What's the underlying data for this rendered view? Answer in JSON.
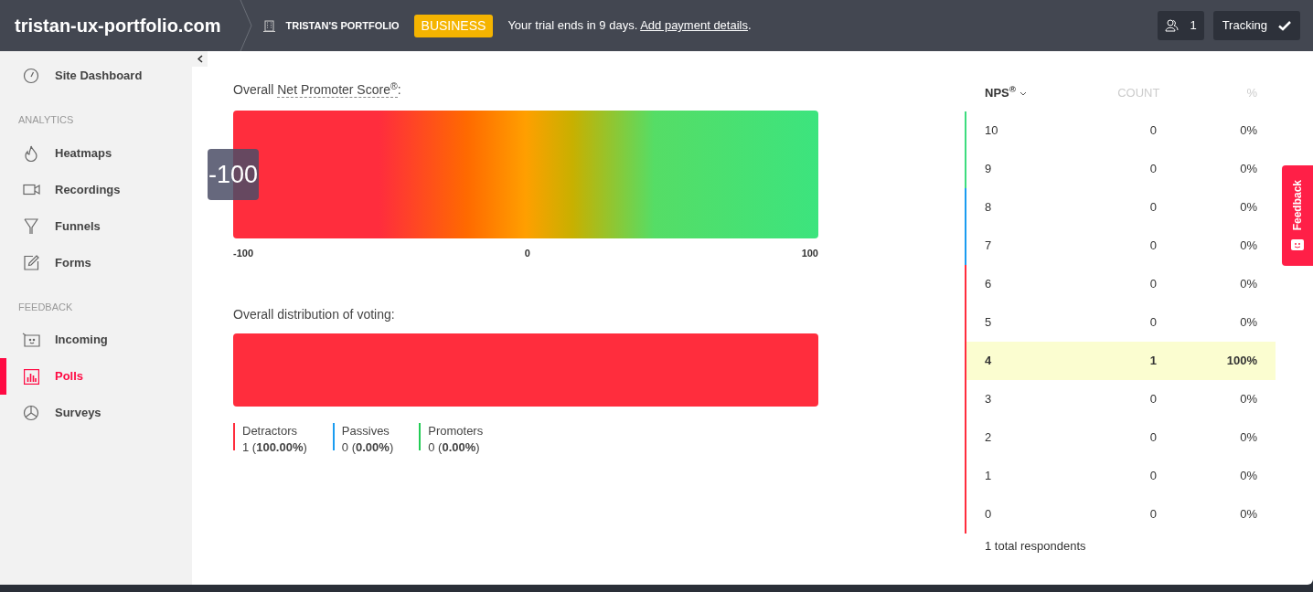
{
  "header": {
    "site": "tristan-ux-portfolio.com",
    "org": "TRISTAN'S PORTFOLIO",
    "plan": "BUSINESS",
    "trial": "Your trial ends in 9 days. ",
    "payment_link": "Add payment details",
    "trial_end": ".",
    "users": "1",
    "tracking": "Tracking"
  },
  "sidebar": {
    "items": [
      {
        "kind": "item",
        "label": "Site Dashboard",
        "selected": false
      },
      {
        "kind": "section",
        "label": "ANALYTICS"
      },
      {
        "kind": "item",
        "label": "Heatmaps",
        "selected": false
      },
      {
        "kind": "item",
        "label": "Recordings",
        "selected": false
      },
      {
        "kind": "item",
        "label": "Funnels",
        "selected": false
      },
      {
        "kind": "item",
        "label": "Forms",
        "selected": false
      },
      {
        "kind": "section",
        "label": "FEEDBACK"
      },
      {
        "kind": "item",
        "label": "Incoming",
        "selected": false
      },
      {
        "kind": "item",
        "label": "Polls",
        "selected": true
      },
      {
        "kind": "item",
        "label": "Surveys",
        "selected": false
      }
    ]
  },
  "nps": {
    "title_before": "Overall ",
    "title_term": "Net Promoter Score$^{®}$",
    "title_after": ":",
    "score": "-100",
    "level": 0,
    "ticks": [
      "-100",
      "0",
      "100"
    ]
  },
  "distribution": {
    "title": "Overall distribution of voting:",
    "groups": [
      {
        "label": "Detractors",
        "count": "1",
        "percent": "(**100.00%**)",
        "color": "#ff2d3d",
        "level": 1
      },
      {
        "label": "Passives",
        "count": "0",
        "percent": "(**0.00%**)",
        "color": "#1a9cf0",
        "level": 0
      },
      {
        "label": "Promoters",
        "count": "0",
        "percent": "(**0.00%**)",
        "color": "#22cc55",
        "level": 0
      }
    ]
  },
  "table": {
    "columns": [
      "NPS$^{®}$",
      "COUNT",
      "%"
    ],
    "rows": [
      {
        "score": "10",
        "count": "0",
        "percent": "0%",
        "color": "#3ddc7e",
        "selected": false
      },
      {
        "score": "9",
        "count": "0",
        "percent": "0%",
        "color": "#3ddc7e",
        "selected": false
      },
      {
        "score": "8",
        "count": "0",
        "percent": "0%",
        "color": "#1a9cf0",
        "selected": false
      },
      {
        "score": "7",
        "count": "0",
        "percent": "0%",
        "color": "#1a9cf0",
        "selected": false
      },
      {
        "score": "6",
        "count": "0",
        "percent": "0%",
        "color": "#ff2d3d",
        "selected": false
      },
      {
        "score": "5",
        "count": "0",
        "percent": "0%",
        "color": "#ff2d3d",
        "selected": false
      },
      {
        "score": "4",
        "count": "1",
        "percent": "100%",
        "color": "#ff2d3d",
        "selected": true
      },
      {
        "score": "3",
        "count": "0",
        "percent": "0%",
        "color": "#ff2d3d",
        "selected": false
      },
      {
        "score": "2",
        "count": "0",
        "percent": "0%",
        "color": "#ff2d3d",
        "selected": false
      },
      {
        "score": "1",
        "count": "0",
        "percent": "0%",
        "color": "#ff2d3d",
        "selected": false
      },
      {
        "score": "0",
        "count": "0",
        "percent": "0%",
        "color": "#ff2d3d",
        "selected": false
      }
    ],
    "footer": "1 total respondents"
  },
  "feedback_tab": "Feedback"
}
